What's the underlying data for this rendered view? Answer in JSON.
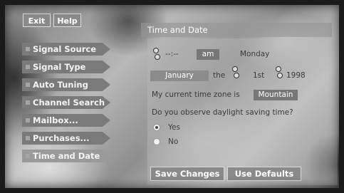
{
  "top_buttons": {
    "exit": "Exit",
    "help": "Help"
  },
  "nav": [
    {
      "label": "Signal Source"
    },
    {
      "label": "Signal Type"
    },
    {
      "label": "Auto Tuning"
    },
    {
      "label": "Channel Search"
    },
    {
      "label": "Mailbox..."
    },
    {
      "label": "Purchases..."
    },
    {
      "label": "Time and Date",
      "active": true
    }
  ],
  "panel": {
    "title": "Time and Date",
    "time": {
      "value": "--:--",
      "ampm": "am",
      "weekday": "Monday"
    },
    "date": {
      "month": "January",
      "the": "the",
      "day": "1st",
      "year": "1998"
    },
    "timezone": {
      "label": "My current time zone is",
      "value": "Mountain"
    },
    "dst": {
      "question": "Do you observe daylight saving time?",
      "options": [
        {
          "label": "Yes",
          "selected": true
        },
        {
          "label": "No",
          "selected": false
        }
      ]
    },
    "buttons": {
      "save": "Save Changes",
      "defaults": "Use Defaults"
    }
  },
  "colors": {
    "button": "#8a8a8a",
    "field": "#777777",
    "text": "#3b3b3b"
  }
}
